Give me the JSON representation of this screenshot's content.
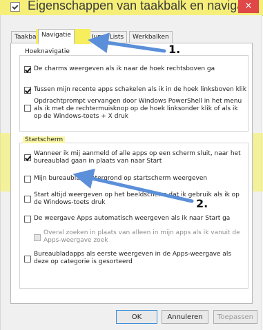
{
  "window": {
    "title": "Eigenschappen van taakbalk en navigatie",
    "close": "×"
  },
  "tabs": [
    "Taakbalk",
    "Navigatie",
    "Jump Lists",
    "Werkbalken"
  ],
  "groups": {
    "corner": {
      "title": "Hoeknavigatie",
      "items": [
        {
          "label": "De charms weergeven als ik naar de hoek rechtsboven ga",
          "checked": true
        },
        {
          "label": "Tussen mijn recente apps schakelen als ik in de hoek linksboven klik",
          "checked": true
        },
        {
          "label": "Opdrachtprompt vervangen door Windows PowerShell in het menu als ik met de rechtermuisknop op de hoek linksonder klik of als ik op de Windows-toets + X druk",
          "checked": false
        }
      ]
    },
    "start": {
      "title": "Startscherm",
      "items": [
        {
          "label": "Wanneer ik mij aanmeld of alle apps op een scherm sluit, naar het bureaublad gaan in plaats van naar Start",
          "checked": true
        },
        {
          "label": "Mijn bureaubladachtergrond op startscherm weergeven",
          "checked": false
        },
        {
          "label": "Start altijd weergeven op het beeldscherm dat ik gebruik als ik op de Windows-toets druk",
          "checked": false
        },
        {
          "label": "De weergave Apps automatisch weergeven als ik naar Start ga",
          "checked": false
        },
        {
          "label": "Overal zoeken in plaats van alleen in mijn apps als ik vanuit de Apps-weergave zoek",
          "checked": false,
          "disabled": true
        },
        {
          "label": "Bureaubladapps als eerste weergeven in de Apps-weergave als deze op categorie is gesorteerd",
          "checked": false
        }
      ]
    }
  },
  "buttons": {
    "ok": "OK",
    "cancel": "Annuleren",
    "apply": "Toepassen"
  },
  "annotations": [
    "1.",
    "2."
  ],
  "colors": {
    "highlight": "#f7f25a",
    "arrow": "#5b8fd9",
    "close": "#e04848"
  }
}
